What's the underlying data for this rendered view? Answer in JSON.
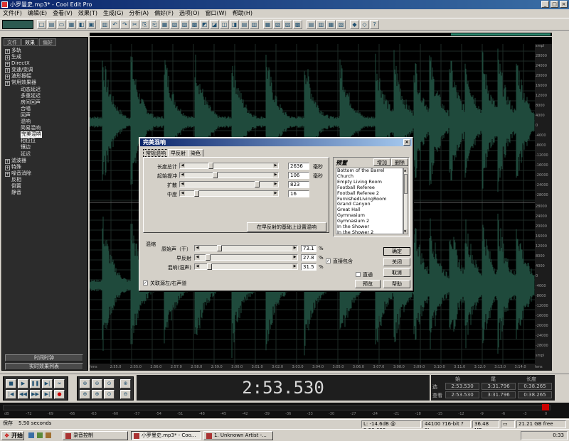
{
  "window": {
    "title": "小罗曼史.mp3* - Cool Edit Pro"
  },
  "menu": [
    "文件(F)",
    "编辑(E)",
    "查看(V)",
    "效果(T)",
    "生成(G)",
    "分析(A)",
    "偏好(F)",
    "选项(O)",
    "窗口(W)",
    "帮助(H)"
  ],
  "left_panel": {
    "tabs": [
      "文件",
      "效果",
      "偏好"
    ],
    "tree": [
      "多轨",
      "生成",
      "DirectX",
      "变速/变调",
      "波形振幅",
      "常用效果器",
      "动态延迟",
      "多重延迟",
      "房间回声",
      "合唱",
      "回声",
      "混响",
      "简易混响",
      "完美混响",
      "相位位",
      "镶边",
      "延迟",
      "滤波器",
      "特殊",
      "噪音消除",
      "反相",
      "倒置",
      "静音"
    ],
    "selected": "完美混响",
    "buttons": [
      "时间时钟",
      "实时效果列表"
    ]
  },
  "ruler": {
    "amps_top": [
      "smpl",
      "28000",
      "24000",
      "20000",
      "16000",
      "12000",
      "8000",
      "4000",
      "0",
      "-4000",
      "-8000",
      "-12000",
      "-16000",
      "-20000",
      "-24000",
      "-28000"
    ],
    "amps_bottom": [
      "28000",
      "24000",
      "20000",
      "16000",
      "12000",
      "8000",
      "4000",
      "0",
      "-4000",
      "-8000",
      "-12000",
      "-16000",
      "-20000",
      "-24000",
      "-28000",
      "smpl"
    ],
    "times": [
      "hms",
      "2:55.0",
      "2:55.0",
      "2:56.0",
      "2:57.0",
      "2:58.0",
      "2:59.0",
      "3:00.0",
      "3:01.0",
      "3:02.0",
      "3:03.0",
      "3:04.0",
      "3:05.0",
      "3:06.0",
      "3:07.0",
      "3:08.0",
      "3:09.0",
      "3:10.0",
      "3:11.0",
      "3:12.0",
      "3:13.0",
      "3:14.0",
      "hms"
    ]
  },
  "transport": {
    "current_time": "2:53.530"
  },
  "selection": {
    "headers": [
      "始",
      "尾",
      "长度"
    ],
    "rows": [
      {
        "label": "选",
        "begin": "2:53.530",
        "end": "3:31.796",
        "length": "0:38.265"
      },
      {
        "label": "查看",
        "begin": "2:53.530",
        "end": "3:31.796",
        "length": "0:38.265"
      }
    ]
  },
  "meter": {
    "labels": [
      "dB",
      "-72",
      "-69",
      "-66",
      "-63",
      "-60",
      "-57",
      "-54",
      "-51",
      "-48",
      "-45",
      "-42",
      "-39",
      "-36",
      "-33",
      "-30",
      "-27",
      "-24",
      "-21",
      "-18",
      "-15",
      "-12",
      "-9",
      "-6",
      "-3",
      "0"
    ]
  },
  "status": {
    "left": "保存",
    "duration": "5.50 seconds",
    "level": "L: -14.6dB @ 2:53.639",
    "format": "44100 ?16-bit ?Stereo",
    "size": "36.48 MB",
    "free": "21.21 GB free"
  },
  "taskbar": {
    "start": "开始",
    "tasks": [
      "录音控制",
      "小罗曼史.mp3* - Coo...",
      "1. Unknown Artist -..."
    ],
    "clock": "0:33"
  },
  "dialog": {
    "title": "完美混响",
    "tabs": [
      "常规混响",
      "早反射",
      "染色"
    ],
    "sliders": [
      {
        "label": "长度总计",
        "value": "2636",
        "unit": "毫秒",
        "pos": 0.28
      },
      {
        "label": "起始提冲",
        "value": "106",
        "unit": "毫秒",
        "pos": 0.33
      },
      {
        "label": "扩散",
        "value": "823",
        "unit": "",
        "pos": 0.84
      },
      {
        "label": "中度",
        "value": "16",
        "unit": "",
        "pos": 0.1
      }
    ],
    "early_button": "在早反射的基础上设置混响",
    "presets": {
      "label": "预置",
      "add": "增加",
      "delete": "删除",
      "items": [
        "Bottom of the Barrel",
        "Church",
        "Empty Living Room",
        "Football Referee",
        "Football Referee 2",
        "FurnishedLivingRoom",
        "Grand Canyon",
        "Great Hall",
        "Gymnasium",
        "Gymnasium 2",
        "In the Shower",
        "In the Shower 2"
      ]
    },
    "mix": {
      "label": "混缩",
      "rows": [
        {
          "label": "原始声（干）",
          "value": "73.1",
          "unit": "%",
          "pos": 0.19
        },
        {
          "label": "早反射",
          "value": "27.8",
          "unit": "%",
          "pos": 0.06
        },
        {
          "label": "混响(湿声)",
          "value": "31.5",
          "unit": "%",
          "pos": 0.07
        }
      ],
      "include_direct": "直接包含",
      "link": "关联源左/右声道"
    },
    "buttons": {
      "ok": "确定",
      "close": "关闭",
      "cancel": "取消",
      "help": "帮助",
      "preview": "预览",
      "bypass": "直通"
    }
  }
}
